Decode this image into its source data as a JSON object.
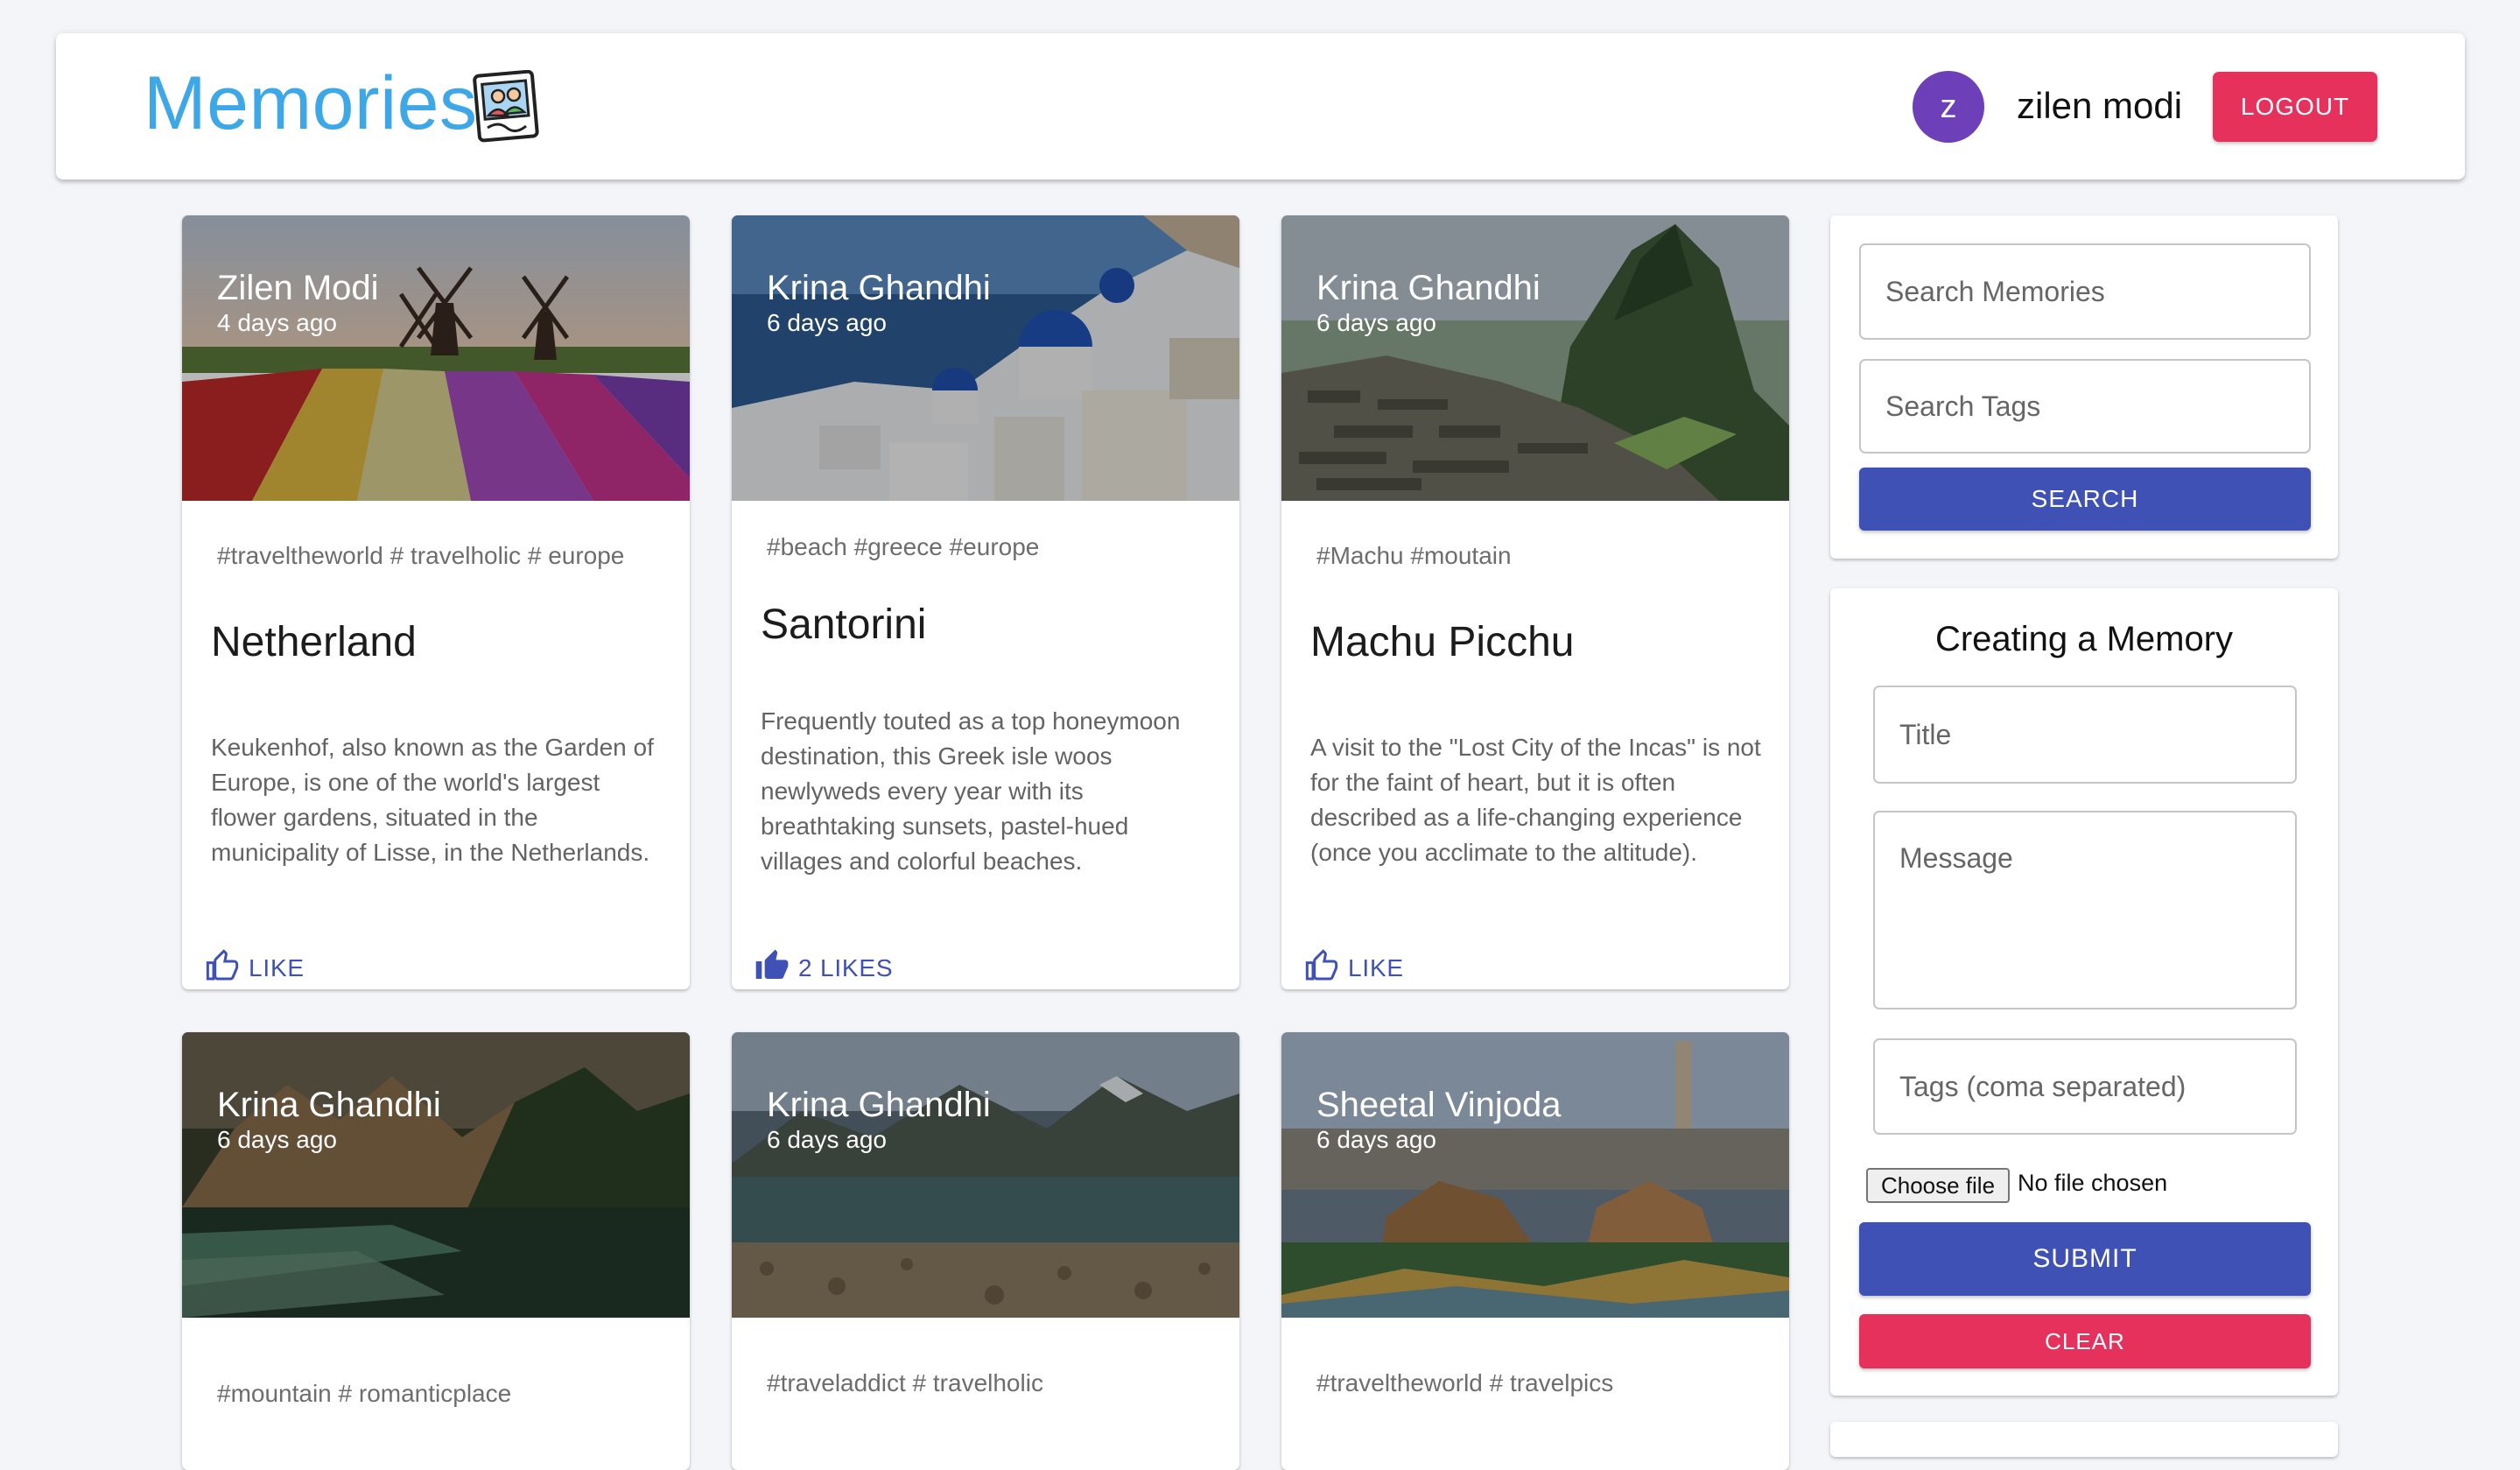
{
  "header": {
    "brand": "Memories",
    "brand_icon": "photo-frame-icon",
    "avatar_letter": "z",
    "user_name": "zilen modi",
    "logout_label": "LOGOUT"
  },
  "colors": {
    "brand": "#3ea7e8",
    "primary": "#3f51b5",
    "danger": "#e5315b",
    "avatar": "#6d3fb8"
  },
  "posts": [
    {
      "author": "Zilen Modi",
      "time": "4 days ago",
      "tags": "#traveltheworld # travelholic # europe",
      "title": "Netherland",
      "message": "Keukenhof, also known as the Garden of Europe, is one of the world's largest flower gardens, situated in the municipality of Lisse, in the Netherlands.",
      "like_label": "LIKE",
      "image": "tulip-fields-windmills"
    },
    {
      "author": "Krina Ghandhi",
      "time": "6 days ago",
      "tags": "#beach #greece #europe",
      "title": "Santorini",
      "message": "Frequently touted as a top honeymoon destination, this Greek isle woos newlyweds every year with its breathtaking sunsets, pastel-hued villages and colorful beaches.",
      "like_label": "2 LIKES",
      "image": "santorini-blue-domes"
    },
    {
      "author": "Krina Ghandhi",
      "time": "6 days ago",
      "tags": "#Machu #moutain",
      "title": "Machu Picchu",
      "message": "A visit to the \"Lost City of the Incas\" is not for the faint of heart, but it is often described as a life-changing experience (once you acclimate to the altitude).",
      "like_label": "LIKE",
      "image": "machu-picchu-ruins"
    },
    {
      "author": "Krina Ghandhi",
      "time": "6 days ago",
      "tags": "#mountain # romanticplace",
      "image": "mountain-lake-forest"
    },
    {
      "author": "Krina Ghandhi",
      "time": "6 days ago",
      "tags": "#traveladdict # travelholic",
      "image": "glacier-lake-pebbles"
    },
    {
      "author": "Sheetal Vinjoda",
      "time": "6 days ago",
      "tags": "#traveltheworld # travelpics",
      "image": "park-guell-barcelona"
    }
  ],
  "search": {
    "memories_placeholder": "Search Memories",
    "tags_placeholder": "Search Tags",
    "button_label": "SEARCH"
  },
  "form": {
    "heading": "Creating a Memory",
    "title_placeholder": "Title",
    "message_placeholder": "Message",
    "tags_placeholder": "Tags (coma separated)",
    "file_button": "Choose file",
    "file_status": "No file chosen",
    "submit_label": "SUBMIT",
    "clear_label": "CLEAR"
  }
}
